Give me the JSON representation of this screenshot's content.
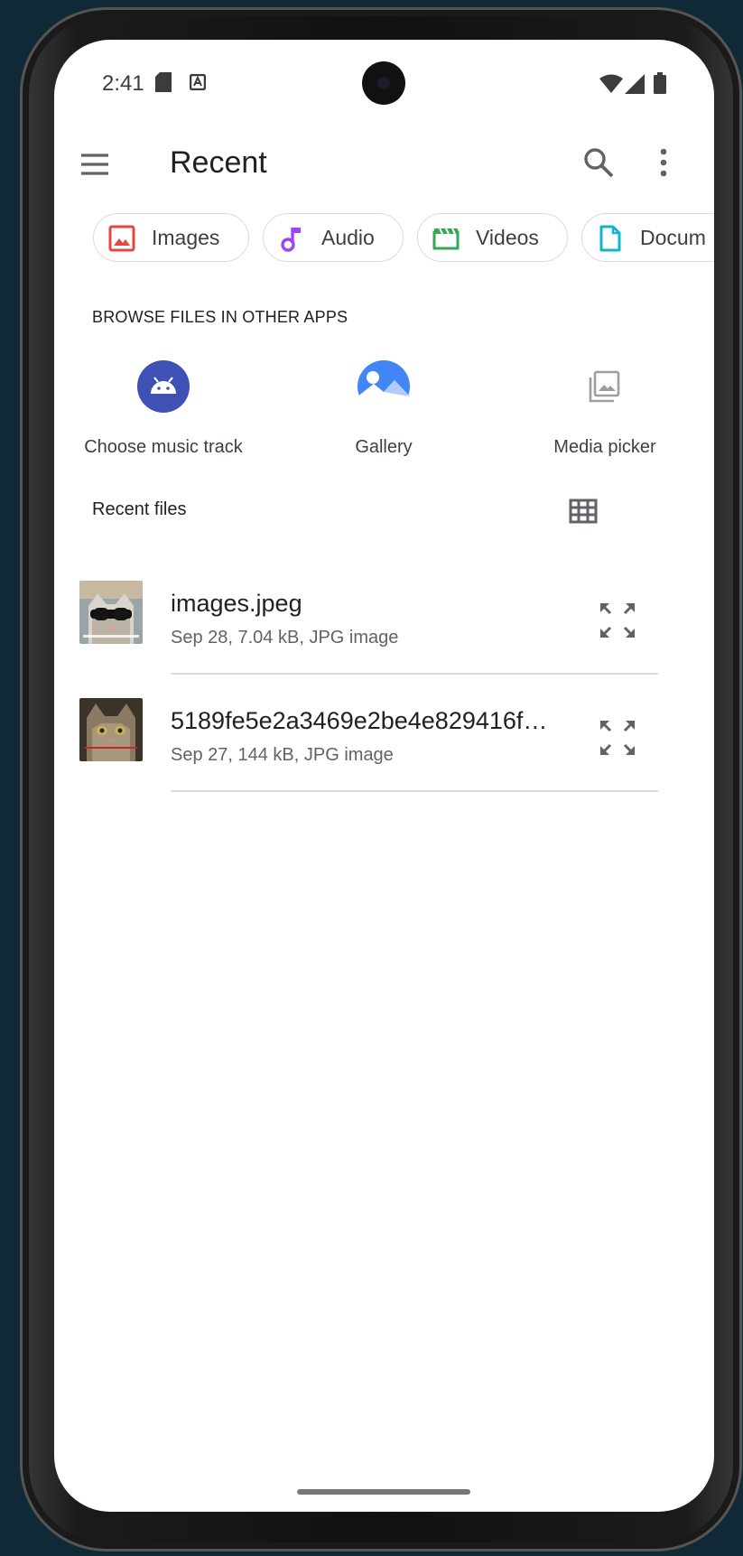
{
  "status_bar": {
    "time": "2:41"
  },
  "app_bar": {
    "title": "Recent"
  },
  "chips": [
    {
      "label": "Images",
      "icon": "image-icon",
      "color": "#e8453c"
    },
    {
      "label": "Audio",
      "icon": "music-note-icon",
      "color": "#a142f4"
    },
    {
      "label": "Videos",
      "icon": "video-clapper-icon",
      "color": "#34a853"
    },
    {
      "label": "Docum",
      "icon": "document-icon",
      "color": "#12b5cb"
    }
  ],
  "browse": {
    "title": "BROWSE FILES IN OTHER APPS",
    "apps": [
      {
        "label": "Choose music track",
        "icon": "android-icon"
      },
      {
        "label": "Gallery",
        "icon": "gallery-icon"
      },
      {
        "label": "Media picker",
        "icon": "media-picker-icon"
      }
    ]
  },
  "recent": {
    "title": "Recent files",
    "files": [
      {
        "name": "images.jpeg",
        "meta": "Sep 28, 7.04 kB, JPG image",
        "thumb": "cat-with-sunglasses"
      },
      {
        "name": "5189fe5e2a3469e2be4e829416f…",
        "meta": "Sep 27, 144 kB, JPG image",
        "thumb": "tabby-cat"
      }
    ]
  },
  "colors": {
    "accent_blue": "#4285f4",
    "android_blue": "#3f51b5"
  }
}
